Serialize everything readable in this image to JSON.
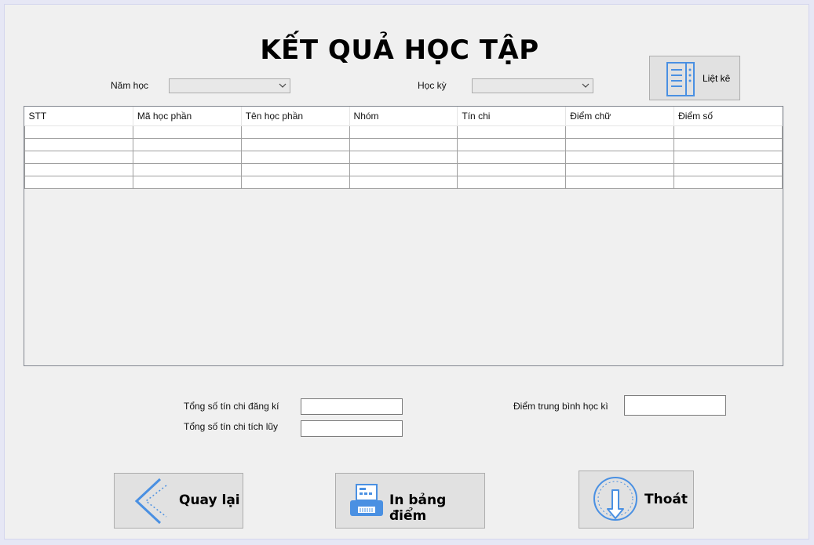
{
  "title": "KẾT QUẢ HỌC TẬP",
  "filters": {
    "year_label": "Năm học",
    "year_value": "",
    "semester_label": "Học kỳ",
    "semester_value": ""
  },
  "list_button": {
    "label": "Liệt kê",
    "icon": "list-icon"
  },
  "table": {
    "columns": [
      "STT",
      "Mã học phần",
      "Tên học phần",
      "Nhóm",
      "Tín chi",
      "Điểm chữ",
      "Điểm số"
    ],
    "rows": [
      [
        "",
        "",
        "",
        "",
        "",
        "",
        ""
      ],
      [
        "",
        "",
        "",
        "",
        "",
        "",
        ""
      ],
      [
        "",
        "",
        "",
        "",
        "",
        "",
        ""
      ],
      [
        "",
        "",
        "",
        "",
        "",
        "",
        ""
      ],
      [
        "",
        "",
        "",
        "",
        "",
        "",
        ""
      ]
    ]
  },
  "summary": {
    "registered_label": "Tổng số tín chi đăng kí",
    "registered_value": "",
    "accumulated_label": "Tổng số tín chi tích lũy",
    "accumulated_value": "",
    "gpa_label": "Điểm trung bình học kì",
    "gpa_value": ""
  },
  "buttons": {
    "back": {
      "label": "Quay lại",
      "icon": "chevron-left-icon"
    },
    "print": {
      "label": "In bảng điểm",
      "icon": "printer-icon"
    },
    "exit": {
      "label": "Thoát",
      "icon": "power-icon"
    }
  },
  "colors": {
    "icon_blue": "#4a90e2",
    "window_bg": "#f0f0f0"
  }
}
